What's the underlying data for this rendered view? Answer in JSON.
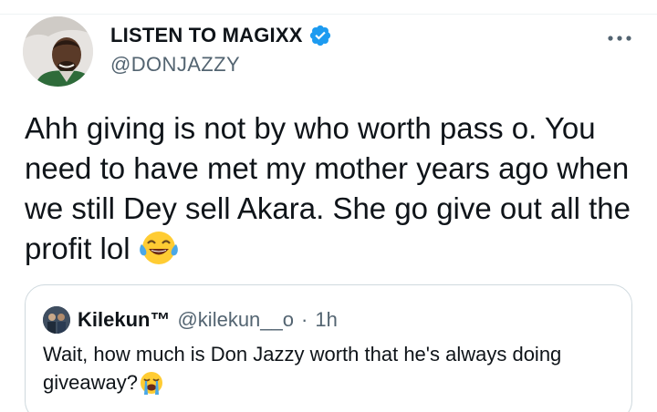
{
  "author": {
    "display_name": "LISTEN TO MAGIXX",
    "handle": "@DONJAZZY",
    "verified": true
  },
  "tweet": {
    "text": "Ahh giving is not by who worth pass o. You need to have met my mother years ago when we still Dey sell Akara. She go give out all the profit lol",
    "emoji": "face-with-tears-of-joy"
  },
  "quoted_tweet": {
    "display_name": "Kilekun™",
    "handle": "@kilekun__o",
    "separator": "·",
    "time": "1h",
    "text": "Wait, how much is Don Jazzy worth that he's always doing giveaway?",
    "emoji": "loudly-crying-face"
  },
  "colors": {
    "verified": "#1d9bf0",
    "text_primary": "#0f1419",
    "text_secondary": "#536471",
    "border": "#cfd9de"
  },
  "icons": {
    "more": "more-horizontal-icon",
    "verified": "verified-badge-icon"
  }
}
